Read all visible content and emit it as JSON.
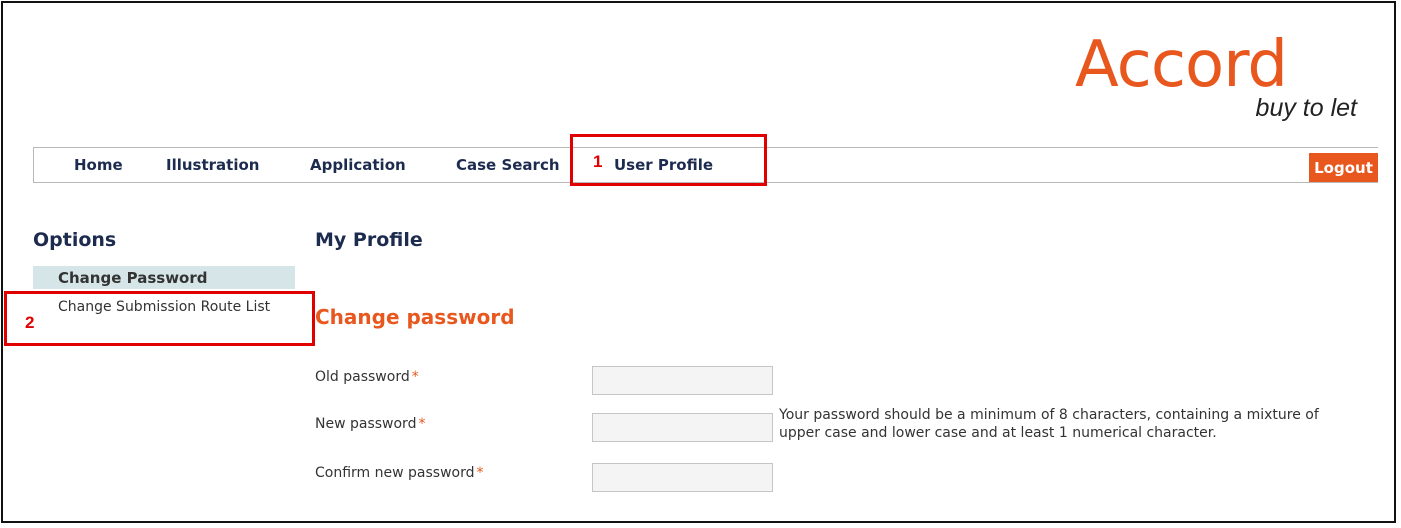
{
  "brand": {
    "logo_text": "Accord",
    "tagline": "buy to let",
    "accent_color": "#e8571e",
    "navy_color": "#1d2b4f"
  },
  "nav": {
    "items": [
      {
        "label": "Home"
      },
      {
        "label": "Illustration"
      },
      {
        "label": "Application"
      },
      {
        "label": "Case Search"
      },
      {
        "label": "User Profile"
      }
    ],
    "logout_label": "Logout"
  },
  "annotations": {
    "callout_1": "1",
    "callout_2": "2",
    "callout_color": "#e00000"
  },
  "sidebar": {
    "title": "Options",
    "items": [
      {
        "label": "Change Password",
        "active": true
      },
      {
        "label": "Change Submission Route List",
        "active": false
      }
    ]
  },
  "main": {
    "page_title": "My Profile",
    "section_title": "Change password",
    "fields": [
      {
        "label": "Old password",
        "required_mark": "*",
        "value": ""
      },
      {
        "label": "New password",
        "required_mark": "*",
        "value": ""
      },
      {
        "label": "Confirm new password",
        "required_mark": "*",
        "value": ""
      }
    ],
    "password_hint": "Your password should be a minimum of 8 characters, containing a mixture of upper case and lower case and at least 1 numerical character."
  }
}
